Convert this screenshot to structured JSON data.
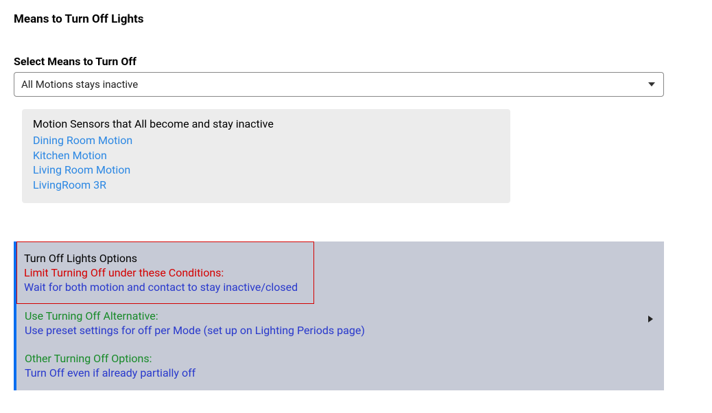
{
  "page": {
    "title": "Means to Turn Off Lights"
  },
  "select": {
    "label": "Select Means to Turn Off",
    "value": "All Motions stays inactive"
  },
  "motion_box": {
    "title": "Motion Sensors that All become and stay inactive",
    "items": [
      "Dining Room Motion",
      "Kitchen Motion",
      "Living Room Motion",
      "LivingRoom 3R"
    ]
  },
  "options_panel": {
    "highlighted": {
      "title": "Turn Off Lights Options",
      "red_label": "Limit Turning Off under these Conditions:",
      "value": "Wait for both motion and contact to stay inactive/closed"
    },
    "alternative": {
      "label": "Use Turning Off Alternative:",
      "value": "Use preset settings for off per Mode (set up on Lighting Periods page)"
    },
    "other": {
      "label": "Other Turning Off Options:",
      "value": "Turn Off even if already partially off"
    }
  }
}
